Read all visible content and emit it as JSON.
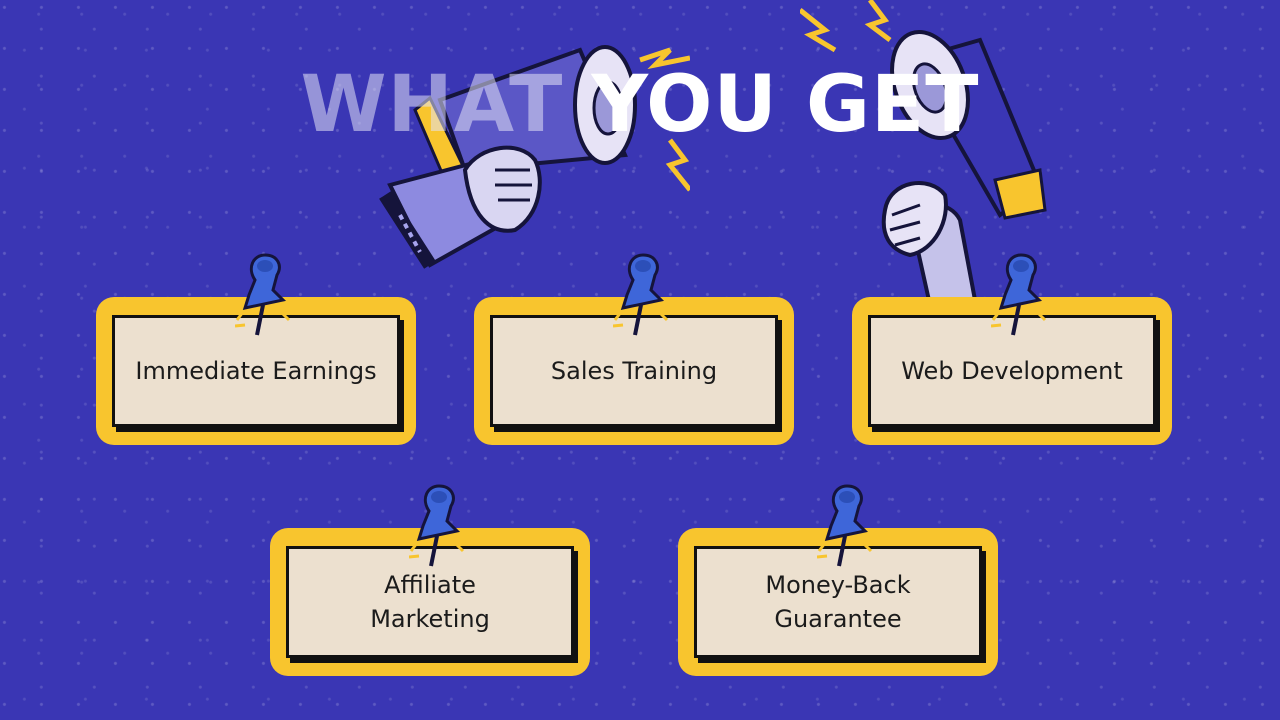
{
  "header": {
    "title_faded": "WHAT",
    "title_main": "YOU GET"
  },
  "benefits": [
    {
      "label": "Immediate Earnings"
    },
    {
      "label": "Sales Training"
    },
    {
      "label": "Web Development"
    },
    {
      "label": "Affiliate\nMarketing"
    },
    {
      "label": "Money-Back\nGuarantee"
    }
  ],
  "icons": {
    "left_megaphone": "megaphone-icon",
    "right_megaphone": "megaphone-icon",
    "pin": "pushpin-icon"
  },
  "colors": {
    "background": "#3a36b4",
    "frame": "#f8c52e",
    "paper": "#ece0cf",
    "pin": "#3e66d9"
  }
}
